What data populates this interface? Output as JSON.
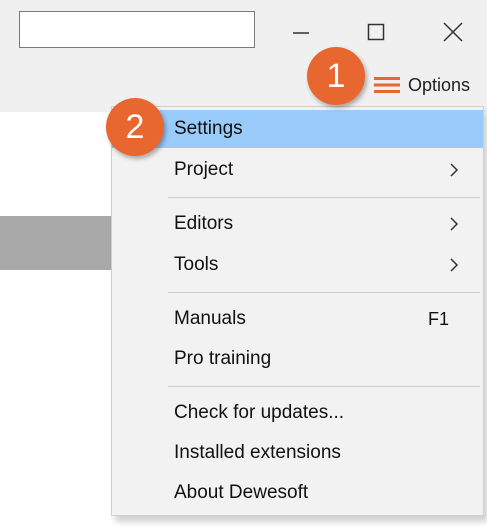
{
  "toolbar": {
    "search_value": "",
    "options_label": "Options"
  },
  "menu": {
    "items": [
      {
        "label": "Settings",
        "shortcut": "",
        "submenu": false
      },
      {
        "label": "Project",
        "shortcut": "",
        "submenu": true
      },
      {
        "label": "Editors",
        "shortcut": "",
        "submenu": true
      },
      {
        "label": "Tools",
        "shortcut": "",
        "submenu": true
      },
      {
        "label": "Manuals",
        "shortcut": "F1",
        "submenu": false
      },
      {
        "label": "Pro training",
        "shortcut": "",
        "submenu": false
      },
      {
        "label": "Check for updates...",
        "shortcut": "",
        "submenu": false
      },
      {
        "label": "Installed extensions",
        "shortcut": "",
        "submenu": false
      },
      {
        "label": "About Dewesoft",
        "shortcut": "",
        "submenu": false
      }
    ]
  },
  "badges": {
    "one": "1",
    "two": "2"
  },
  "colors": {
    "highlight": "#99cbfb",
    "badge": "#e8662f",
    "options_icon": "#e8662f"
  },
  "icons": {
    "minimize": "minimize-icon",
    "maximize": "maximize-icon",
    "close": "close-icon",
    "options": "hamburger-icon",
    "submenu": "chevron-right-icon"
  }
}
